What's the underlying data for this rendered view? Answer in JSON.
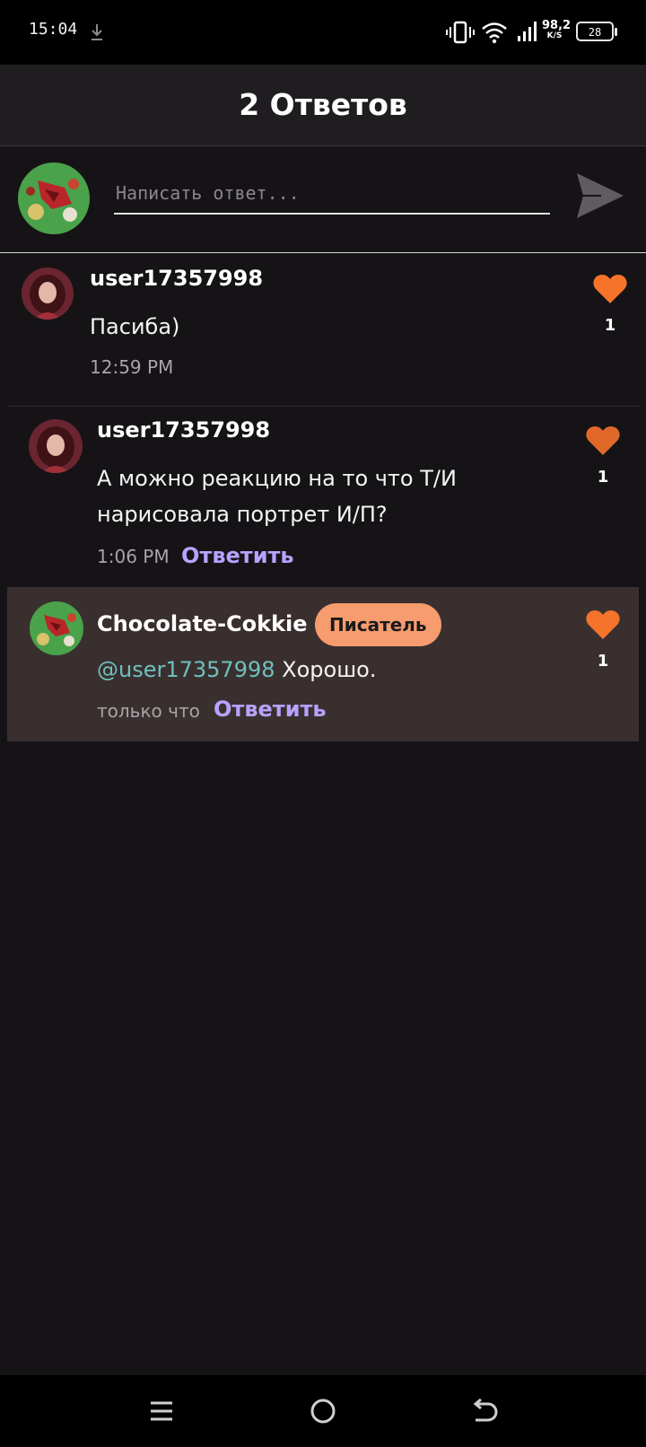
{
  "status_bar": {
    "time": "15:04",
    "net_speed_value": "98,2",
    "net_speed_unit": "K/S",
    "battery_level": "28",
    "icons": [
      "download-icon",
      "vibrate-icon",
      "wifi-icon",
      "signal-icon",
      "battery-icon"
    ]
  },
  "header": {
    "title": "2 Ответов"
  },
  "composer": {
    "placeholder": "Написать ответ...",
    "icons": [
      "avatar",
      "send-icon"
    ]
  },
  "comments": [
    {
      "username": "user17357998",
      "text": "Пасиба)",
      "time": "12:59 PM",
      "likes": "1"
    },
    {
      "username": "user17357998",
      "text_line1": "А можно реакцию на то что Т/И",
      "text_line2": "нарисовала портрет И/П?",
      "time": "1:06 PM",
      "reply_label": "Ответить",
      "likes": "1"
    },
    {
      "username": "Chocolate-Cokkie",
      "badge": "Писатель",
      "mention": "@user17357998",
      "text": " Хорошо.",
      "time": "только что",
      "reply_label": "Ответить",
      "likes": "1"
    }
  ],
  "colors": {
    "background": "#151316",
    "heart": "#f5732b",
    "reply_link": "#b5a3ff",
    "badge": "#f79c6e",
    "mention": "#6ec0bd",
    "highlight_row": "#3a2f2f"
  },
  "navbar": {
    "icons": [
      "menu-icon",
      "home-icon",
      "back-icon"
    ]
  }
}
